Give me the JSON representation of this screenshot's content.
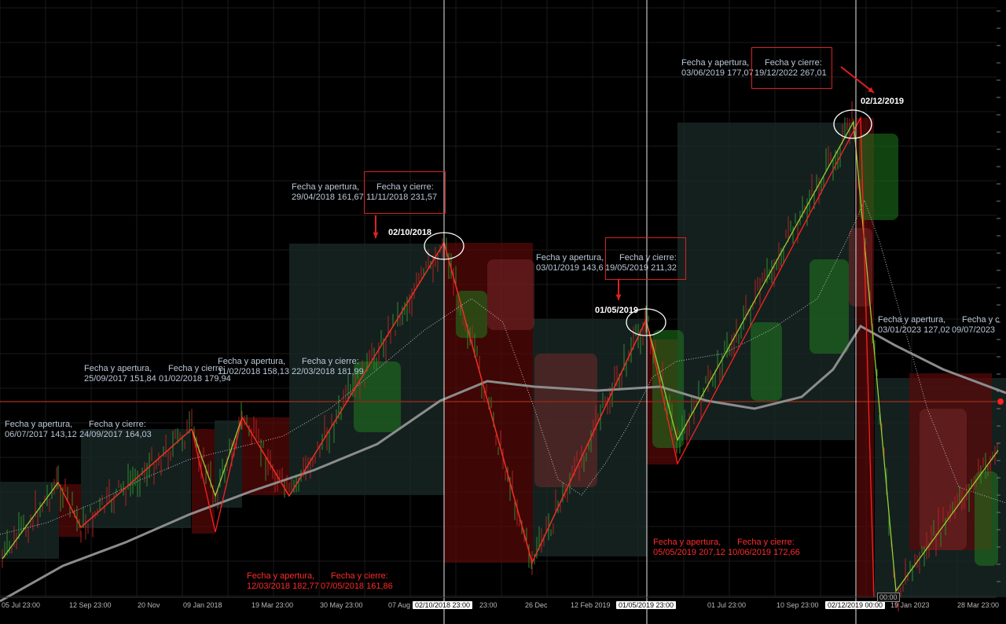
{
  "chart_data": {
    "type": "candlestick",
    "x_ticks": [
      "05 Jul 23:00",
      "12 Sep 23:00",
      "20 Nov",
      "09 Jan 2018",
      "19 Mar 23:00",
      "30 May 23:00",
      "07 Aug",
      "02/10/2018 23:00",
      "23:00",
      "26 Dec",
      "12 Feb 2019",
      "01/05/2019 23:00",
      "01 Jul 23:00",
      "10 Sep 23:00",
      "02/12/2019 00:00",
      "00:00",
      "19 Jan 2023",
      "28 Mar 23:00"
    ],
    "annotations": [
      {
        "open_label": "Fecha y apertura,",
        "open": "06/07/2017 143,12",
        "close_label": "Fecha y cierre:",
        "close": "24/09/2017 164,03"
      },
      {
        "open_label": "Fecha y apertura,",
        "open": "25/09/2017 151,84",
        "close_label": "Fecha y cierre:",
        "close": "01/02/2018 179,94"
      },
      {
        "open_label": "Fecha y apertura,",
        "open": "11/02/2018 158,13",
        "close_label": "Fecha y cierre:",
        "close": "22/03/2018 181,99"
      },
      {
        "open_label": "Fecha y apertura,",
        "open": "29/04/2018 161,67",
        "close_label": "Fecha y cierre:",
        "close": "11/11/2018 231,57"
      },
      {
        "open_label": "Fecha y apertura,",
        "open": "12/03/2018 182,77",
        "close_label": "Fecha y cierre:",
        "close": "07/05/2018 161,86"
      },
      {
        "open_label": "Fecha y apertura,",
        "open": "03/01/2019 143,6",
        "close_label": "Fecha y cierre:",
        "close": "19/05/2019 211,32"
      },
      {
        "open_label": "Fecha y apertura,",
        "open": "05/05/2019 207,12",
        "close_label": "Fecha y cierre:",
        "close": "10/06/2019 172,66"
      },
      {
        "open_label": "Fecha y apertura,",
        "open": "03/06/2019 177,07",
        "close_label": "Fecha y cierre:",
        "close": "19/12/2022 267,01"
      },
      {
        "open_label": "Fecha y apertura,",
        "open": "03/01/2023 127,02",
        "close_label": "Fecha y c",
        "close": "09/07/2023"
      }
    ],
    "markers": [
      "02/10/2018",
      "01/05/2019",
      "02/12/2019"
    ],
    "zigzag_up": [
      [
        3,
        711
      ],
      [
        74,
        614
      ],
      [
        103,
        671
      ],
      [
        244,
        546
      ],
      [
        274,
        631
      ],
      [
        308,
        531
      ],
      [
        368,
        631
      ],
      [
        565,
        309
      ],
      [
        677,
        716
      ],
      [
        822,
        407
      ],
      [
        862,
        560
      ],
      [
        1086,
        155
      ],
      [
        1140,
        752
      ],
      [
        1270,
        573
      ]
    ],
    "zigzag_down": [
      [
        74,
        614
      ],
      [
        103,
        671
      ],
      [
        244,
        546
      ],
      [
        274,
        677
      ],
      [
        308,
        531
      ],
      [
        368,
        631
      ],
      [
        565,
        309
      ],
      [
        677,
        716
      ],
      [
        822,
        407
      ],
      [
        862,
        590
      ],
      [
        1095,
        150
      ],
      [
        1112,
        760
      ]
    ],
    "sma_long": [
      [
        0,
        765
      ],
      [
        80,
        720
      ],
      [
        160,
        690
      ],
      [
        240,
        655
      ],
      [
        320,
        625
      ],
      [
        400,
        598
      ],
      [
        480,
        565
      ],
      [
        560,
        510
      ],
      [
        620,
        485
      ],
      [
        680,
        492
      ],
      [
        760,
        497
      ],
      [
        840,
        492
      ],
      [
        900,
        510
      ],
      [
        960,
        520
      ],
      [
        1020,
        505
      ],
      [
        1060,
        470
      ],
      [
        1095,
        415
      ],
      [
        1140,
        440
      ],
      [
        1200,
        470
      ],
      [
        1280,
        500
      ]
    ],
    "sma_short": [
      [
        0,
        680
      ],
      [
        60,
        665
      ],
      [
        120,
        640
      ],
      [
        180,
        610
      ],
      [
        240,
        585
      ],
      [
        300,
        570
      ],
      [
        360,
        555
      ],
      [
        420,
        520
      ],
      [
        480,
        470
      ],
      [
        540,
        420
      ],
      [
        600,
        380
      ],
      [
        640,
        410
      ],
      [
        680,
        520
      ],
      [
        710,
        610
      ],
      [
        740,
        630
      ],
      [
        770,
        590
      ],
      [
        800,
        540
      ],
      [
        830,
        480
      ],
      [
        860,
        460
      ],
      [
        920,
        450
      ],
      [
        980,
        420
      ],
      [
        1040,
        380
      ],
      [
        1080,
        300
      ],
      [
        1100,
        255
      ],
      [
        1120,
        310
      ],
      [
        1140,
        380
      ],
      [
        1180,
        520
      ],
      [
        1220,
        620
      ],
      [
        1280,
        640
      ]
    ],
    "zones_green": [
      [
        0,
        613,
        75,
        98
      ],
      [
        103,
        546,
        140,
        126
      ],
      [
        273,
        535,
        35,
        111
      ],
      [
        368,
        310,
        197,
        320
      ],
      [
        678,
        406,
        145,
        302
      ],
      [
        862,
        156,
        225,
        404
      ],
      [
        1113,
        481,
        167,
        279
      ]
    ],
    "zones_red": [
      [
        75,
        616,
        28,
        67
      ],
      [
        244,
        546,
        29,
        133
      ],
      [
        308,
        531,
        60,
        99
      ],
      [
        565,
        309,
        113,
        407
      ],
      [
        823,
        432,
        39,
        159
      ],
      [
        1090,
        150,
        22,
        610
      ],
      [
        1157,
        475,
        105,
        225
      ]
    ],
    "cloud_green": [
      [
        580,
        370,
        40,
        60
      ],
      [
        830,
        420,
        40,
        150
      ],
      [
        955,
        410,
        40,
        100
      ],
      [
        1030,
        330,
        50,
        120
      ],
      [
        1093,
        170,
        50,
        110
      ],
      [
        1240,
        600,
        30,
        120
      ],
      [
        450,
        460,
        60,
        90
      ]
    ],
    "cloud_red": [
      [
        620,
        330,
        60,
        90
      ],
      [
        680,
        450,
        80,
        170
      ],
      [
        1080,
        290,
        30,
        100
      ],
      [
        1170,
        520,
        60,
        180
      ]
    ],
    "vlines": [
      565,
      823,
      1089
    ],
    "hline": 511,
    "colors": {
      "up": "#9acd32",
      "down": "#ff2020",
      "zone_green": "#1b2b28",
      "zone_red": "#5a0808",
      "sma_long": "#8c8c8c"
    }
  },
  "labels": {
    "a1_open": "Fecha y apertura,",
    "a1_open_v": "06/07/2017 143,12",
    "a1_close": "Fecha y cierre:",
    "a1_close_v": "24/09/2017 164,03",
    "a2_open": "Fecha y apertura,",
    "a2_open_v": "25/09/2017 151,84",
    "a2_close": "Fecha y cierre:",
    "a2_close_v": "01/02/2018 179,94",
    "a3_open": "Fecha y apertura,",
    "a3_open_v": "11/02/2018 158,13",
    "a3_close": "Fecha y cierre:",
    "a3_close_v": "22/03/2018 181,99",
    "a4_open": "Fecha y apertura,",
    "a4_open_v": "29/04/2018 161,67",
    "a4_close": "Fecha y cierre:",
    "a4_close_v": "11/11/2018 231,57",
    "a5_open": "Fecha y apertura,",
    "a5_open_v": "12/03/2018 182,77",
    "a5_close": "Fecha y cierre:",
    "a5_close_v": "07/05/2018 161,86",
    "a6_open": "Fecha y apertura,",
    "a6_open_v": "03/01/2019 143,6",
    "a6_close": "Fecha y cierre:",
    "a6_close_v": "19/05/2019 211,32",
    "a7_open": "Fecha y apertura,",
    "a7_open_v": "05/05/2019 207,12",
    "a7_close": "Fecha y cierre:",
    "a7_close_v": "10/06/2019 172,66",
    "a8_open": "Fecha y apertura,",
    "a8_open_v": "03/06/2019 177,07",
    "a8_close": "Fecha y cierre:",
    "a8_close_v": "19/12/2022 267,01",
    "a9_open": "Fecha y apertura,",
    "a9_open_v": "03/01/2023 127,02",
    "a9_close": "Fecha y c",
    "a9_close_v": "09/07/2023",
    "m1": "02/10/2018",
    "m2": "01/05/2019",
    "m3": "02/12/2019",
    "cursor_price": "00:00"
  }
}
